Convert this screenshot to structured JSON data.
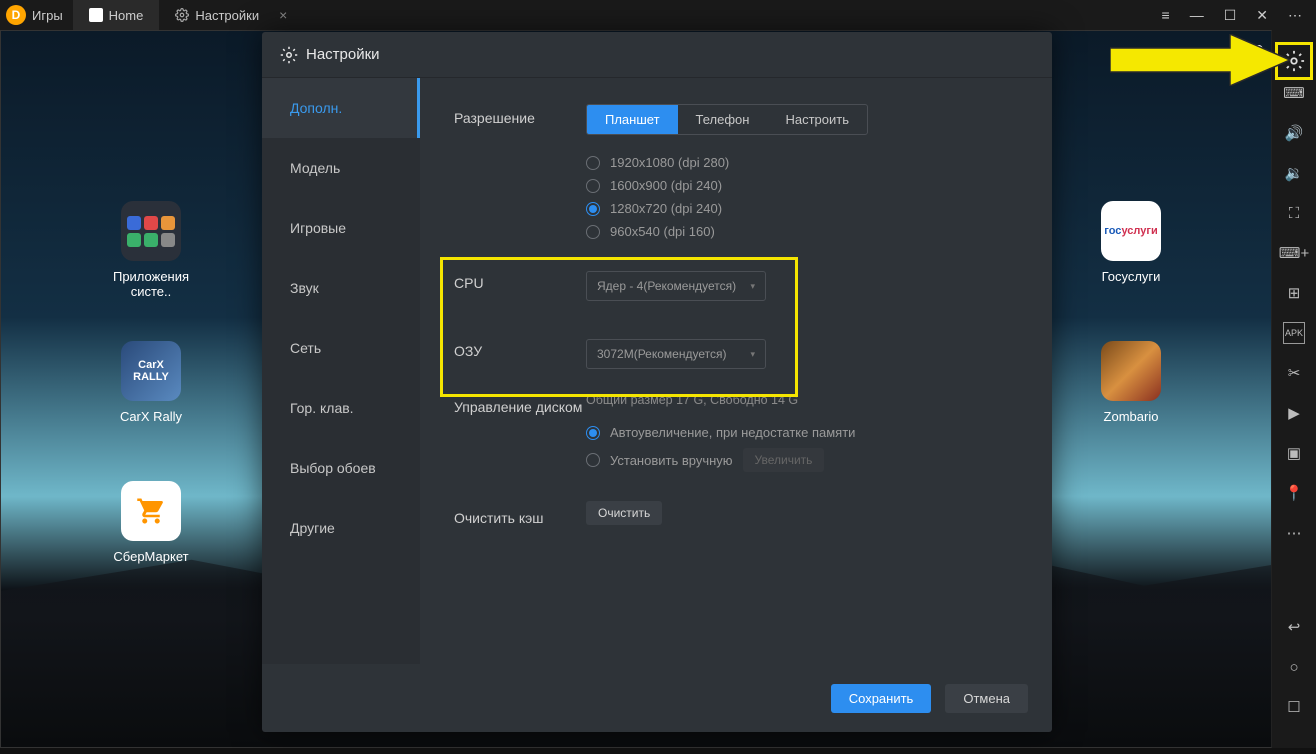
{
  "topbar": {
    "games_label": "Игры",
    "home_label": "Home",
    "settings_label": "Настройки"
  },
  "clock_fragment": ":30",
  "desktop_icons": {
    "apps": "Приложения систе..",
    "carx": "CarX Rally",
    "sber": "СберМаркет",
    "gos": "Госуслуги",
    "zomb": "Zombario"
  },
  "modal": {
    "title": "Настройки",
    "sidebar": [
      "Дополн.",
      "Модель",
      "Игровые",
      "Звук",
      "Сеть",
      "Гор. клав.",
      "Выбор обоев",
      "Другие"
    ],
    "labels": {
      "resolution": "Разрешение",
      "cpu": "CPU",
      "ram": "ОЗУ",
      "disk": "Управление диском",
      "cache": "Очистить кэш"
    },
    "segments": {
      "tablet": "Планшет",
      "phone": "Телефон",
      "custom": "Настроить"
    },
    "resolutions": {
      "r1": "1920x1080  (dpi 280)",
      "r2": "1600x900  (dpi 240)",
      "r3": "1280x720  (dpi 240)",
      "r4": "960x540  (dpi 160)"
    },
    "cpu_value": "Ядер - 4(Рекомендуется)",
    "ram_value": "3072M(Рекомендуется)",
    "disk_info": "Общий размер 17 G,   Свободно 14 G",
    "disk_opts": {
      "auto": "Автоувеличение, при недостатке памяти",
      "manual": "Установить вручную",
      "enlarge": "Увеличить"
    },
    "clear_btn": "Очистить",
    "save": "Сохранить",
    "cancel": "Отмена"
  }
}
